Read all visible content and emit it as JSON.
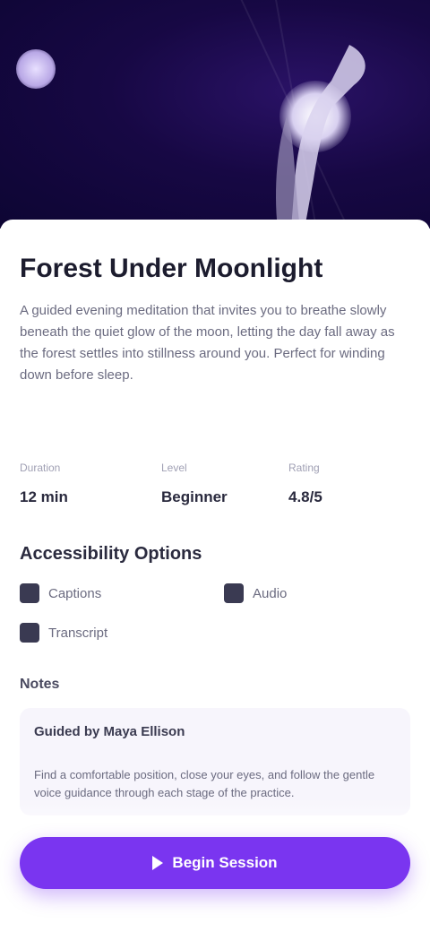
{
  "hero": {
    "image": "meditation-artwork"
  },
  "session": {
    "title": "Forest Under Moonlight",
    "description": "A guided evening meditation that invites you to breathe slowly beneath the quiet glow of the moon, letting the day fall away as the forest settles into stillness around you. Perfect for winding down before sleep.",
    "stats": [
      {
        "label": "Duration",
        "value": "12 min"
      },
      {
        "label": "Level",
        "value": "Beginner"
      },
      {
        "label": "Rating",
        "value": "4.8/5"
      }
    ]
  },
  "accessibility": {
    "title": "Accessibility Options",
    "options": [
      "Captions",
      "Audio",
      "Transcript"
    ]
  },
  "notes": {
    "title": "Notes",
    "card_title": "Guided by Maya Ellison",
    "card_text": "Find a comfortable position, close your eyes, and follow the gentle voice guidance through each stage of the practice."
  },
  "cta": {
    "label": "Begin Session"
  },
  "colors": {
    "accent": "#7a35f0",
    "hero_bg": "#170844"
  }
}
